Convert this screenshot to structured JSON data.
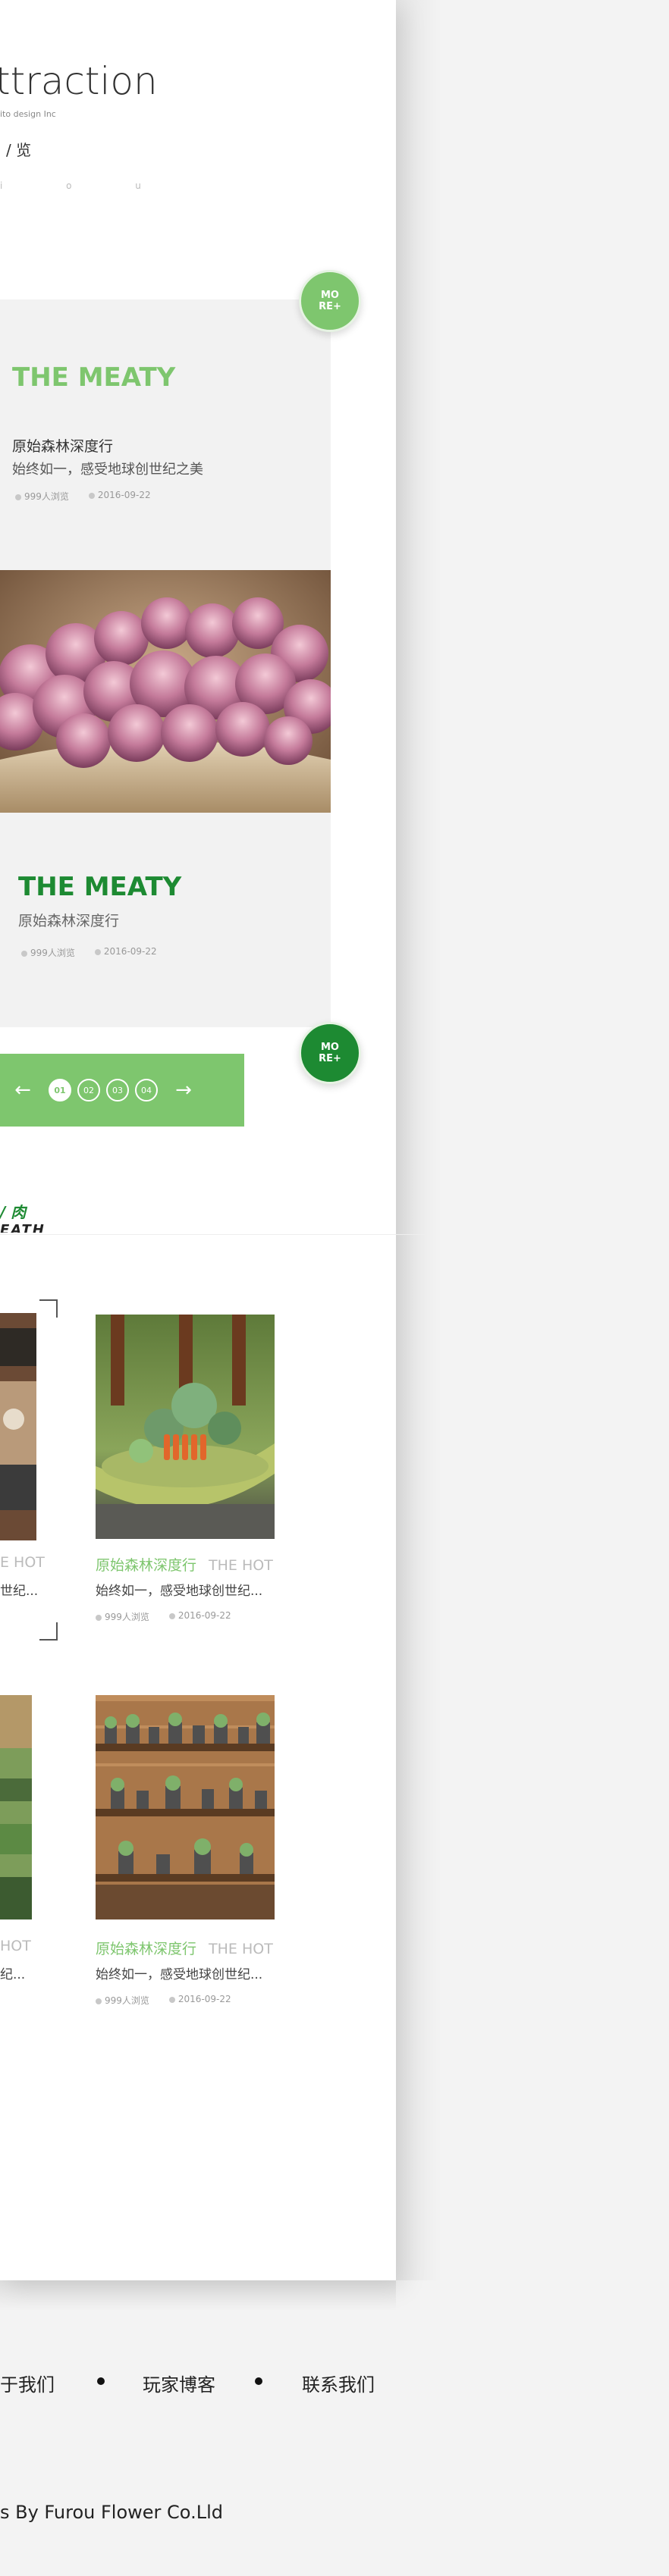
{
  "hero": {
    "title": "ttraction",
    "subtitle": "ito design Inc",
    "nav": "/ 览",
    "letters": "i o u"
  },
  "more_label": "MO\nRE",
  "more_light": "MO RE+",
  "more_dark": "MO RE+",
  "feature": {
    "card1": {
      "title": "THE MEATY",
      "name": "原始森林深度行",
      "desc": "始终如一，感受地球创世纪之美",
      "views": "999人浏览",
      "date": "2016-09-22"
    },
    "card2": {
      "title": "THE MEATY",
      "desc": "原始森林深度行",
      "views": "999人浏览",
      "date": "2016-09-22"
    }
  },
  "pager": {
    "prev_icon": "←",
    "next_icon": "→",
    "pages": [
      "01",
      "02",
      "03",
      "04"
    ],
    "active": "01"
  },
  "section2": {
    "title": "/ 肉",
    "subtitle": "EATH"
  },
  "grid": {
    "left_col_top": {
      "hot": "E HOT",
      "desc": "世纪..."
    },
    "left_col_bottom": {
      "hot": "HOT",
      "desc": "纪..."
    },
    "item1": {
      "name": "原始森林深度行",
      "hot": "THE HOT",
      "desc": "始终如一，感受地球创世纪...",
      "views": "999人浏览",
      "date": "2016-09-22"
    },
    "item2": {
      "name": "原始森林深度行",
      "hot": "THE HOT",
      "desc": "始终如一，感受地球创世纪...",
      "views": "999人浏览",
      "date": "2016-09-22"
    }
  },
  "footer": {
    "links": [
      "关于我们",
      "玩家博客",
      "联系我们"
    ],
    "first_link_visible": "于我们",
    "copyright": "s By Furou Flower Co.Lld"
  },
  "colors": {
    "accent_light": "#7ec66e",
    "accent_dark": "#1d8a32"
  }
}
